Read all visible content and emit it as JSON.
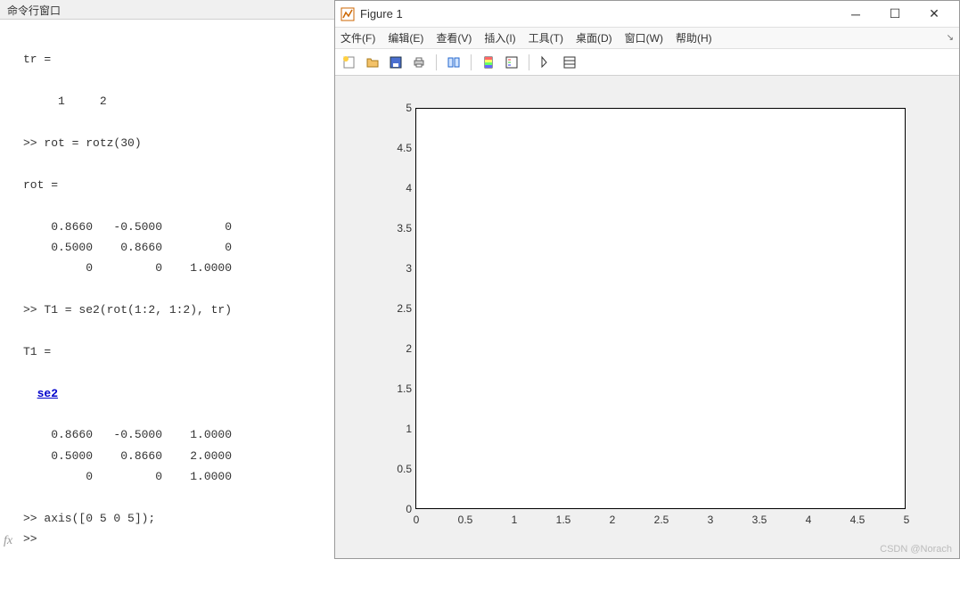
{
  "command_window": {
    "title": "命令行窗口",
    "fx_symbol": "fx",
    "lines": {
      "l0": "tr =",
      "l1": "",
      "l2": "     1     2",
      "l3": "",
      "l4": ">> rot = rotz(30)",
      "l5": "",
      "l6": "rot =",
      "l7": "",
      "l8": "    0.8660   -0.5000         0",
      "l9": "    0.5000    0.8660         0",
      "l10": "         0         0    1.0000",
      "l11": "",
      "l12": ">> T1 = se2(rot(1:2, 1:2), tr)",
      "l13": "",
      "l14": "T1 = ",
      "l15": "",
      "se2_link": "se2",
      "l17": "",
      "l18": "    0.8660   -0.5000    1.0000",
      "l19": "    0.5000    0.8660    2.0000",
      "l20": "         0         0    1.0000",
      "l21": "",
      "l22": ">> axis([0 5 0 5]);",
      "l23": ">> "
    }
  },
  "figure": {
    "title": "Figure 1",
    "menus": {
      "file": "文件(F)",
      "edit": "编辑(E)",
      "view": "查看(V)",
      "insert": "插入(I)",
      "tools": "工具(T)",
      "desktop": "桌面(D)",
      "window": "窗口(W)",
      "help": "帮助(H)"
    }
  },
  "chart_data": {
    "type": "scatter",
    "series": [],
    "x_ticks": [
      0,
      0.5,
      1,
      1.5,
      2,
      2.5,
      3,
      3.5,
      4,
      4.5,
      5
    ],
    "y_ticks": [
      0,
      0.5,
      1,
      1.5,
      2,
      2.5,
      3,
      3.5,
      4,
      4.5,
      5
    ],
    "xlim": [
      0,
      5
    ],
    "ylim": [
      0,
      5
    ],
    "title": "",
    "xlabel": "",
    "ylabel": ""
  },
  "watermark": "CSDN @Norach"
}
